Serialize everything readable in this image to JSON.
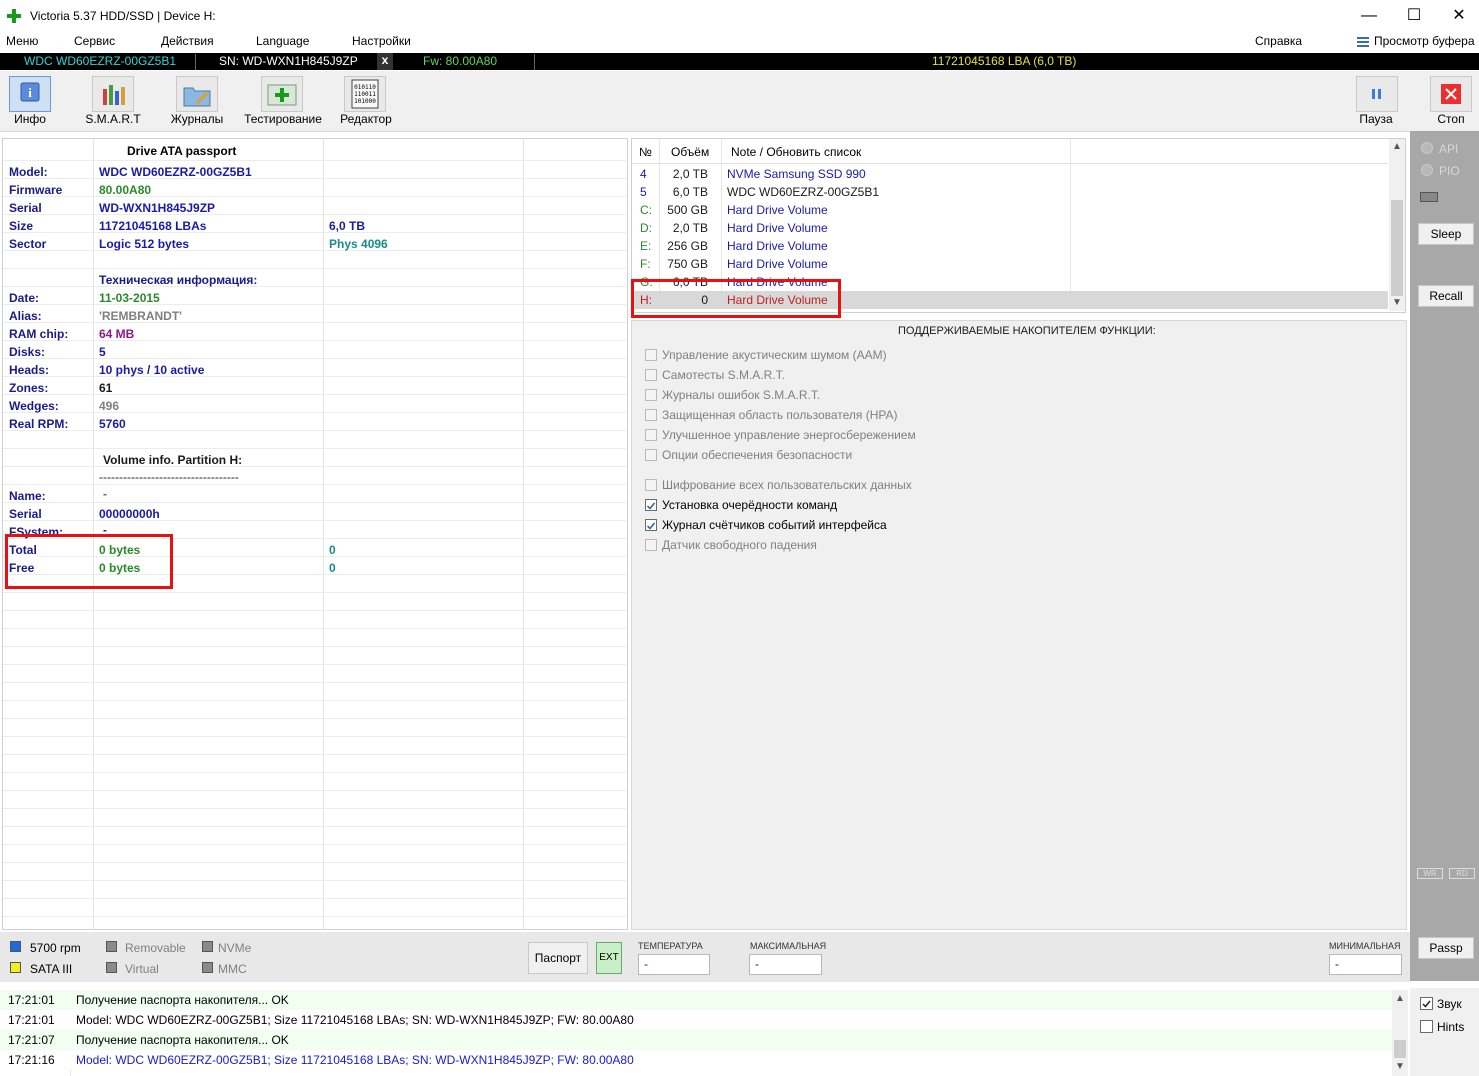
{
  "window": {
    "title": "Victoria 5.37 HDD/SSD | Device H:",
    "min": "—",
    "max": "☐",
    "close": "✕"
  },
  "menu": {
    "items": [
      "Меню",
      "Сервис",
      "Действия",
      "Language",
      "Настройки"
    ],
    "help": "Справка",
    "buffer": "Просмотр буфера"
  },
  "strip": {
    "model": "WDC WD60EZRZ-00GZ5B1",
    "serial": "SN: WD-WXN1H845J9ZP",
    "close": "x",
    "fw": "Fw: 80.00A80",
    "lba": "11721045168 LBA (6,0 TB)"
  },
  "toolbar": {
    "info": "Инфо",
    "smart": "S.M.A.R.T",
    "logs": "Журналы",
    "test": "Тестирование",
    "editor": "Редактор",
    "pause": "Пауза",
    "stop": "Стоп"
  },
  "passport": {
    "header": "Drive ATA passport",
    "model_label": "Model:",
    "model": "WDC WD60EZRZ-00GZ5B1",
    "firmware_label": "Firmware",
    "firmware": "80.00A80",
    "serial_label": "Serial",
    "serial": "WD-WXN1H845J9ZP",
    "size_label": "Size",
    "size": "11721045168 LBAs",
    "size2": "6,0 TB",
    "sector_label": "Sector",
    "sector": "Logic 512 bytes",
    "sector2": "Phys 4096",
    "tech_header": "Техническая информация:",
    "date_label": "Date:",
    "date": "11-03-2015",
    "alias_label": "Alias:",
    "alias": "'REMBRANDT'",
    "ram_label": "RAM chip:",
    "ram": "64 MB",
    "disks_label": "Disks:",
    "disks": "5",
    "heads_label": "Heads:",
    "heads": "10 phys / 10 active",
    "zones_label": "Zones:",
    "zones": "61",
    "wedges_label": "Wedges:",
    "wedges": "496",
    "rpm_label": "Real RPM:",
    "rpm": "5760",
    "vol_header": "Volume info. Partition H:",
    "vol_sep": "-----------------------------------",
    "name_label": "Name:",
    "name": "-",
    "vserial_label": "Serial",
    "vserial": "00000000h",
    "fs_label": "FSystem:",
    "fs": "-",
    "total_label": "Total",
    "total": "0 bytes",
    "total2": "0",
    "free_label": "Free",
    "free": "0 bytes",
    "free2": "0"
  },
  "drives": {
    "col_no": "№",
    "col_size": "Объём",
    "col_note": "Note / Обновить список",
    "rows": [
      {
        "no": "4",
        "size": "2,0 TB",
        "note": "NVMe     Samsung SSD 990"
      },
      {
        "no": "5",
        "size": "6,0 TB",
        "note": "WDC WD60EZRZ-00GZ5B1"
      },
      {
        "no": "C:",
        "size": "500 GB",
        "note": "Hard Drive Volume"
      },
      {
        "no": "D:",
        "size": "2,0 TB",
        "note": "Hard Drive Volume"
      },
      {
        "no": "E:",
        "size": "256 GB",
        "note": "Hard Drive Volume"
      },
      {
        "no": "F:",
        "size": "750 GB",
        "note": "Hard Drive Volume"
      },
      {
        "no": "G:",
        "size": "6,0 TB",
        "note": "Hard Drive Volume"
      },
      {
        "no": "H:",
        "size": "0",
        "note": "Hard Drive Volume"
      }
    ]
  },
  "features": {
    "header": "ПОДДЕРЖИВАЕМЫЕ НАКОПИТЕЛЕМ ФУНКЦИИ:",
    "items": [
      {
        "label": "Управление акустическим шумом (AAM)",
        "checked": false
      },
      {
        "label": "Самотесты S.M.A.R.T.",
        "checked": false
      },
      {
        "label": "Журналы ошибок S.M.A.R.T.",
        "checked": false
      },
      {
        "label": "Защищенная область пользователя (HPA)",
        "checked": false
      },
      {
        "label": "Улучшенное управление энергосбережением",
        "checked": false
      },
      {
        "label": "Опции обеспечения безопасности",
        "checked": false
      },
      {
        "label": "Шифрование всех пользовательских данных",
        "checked": false
      },
      {
        "label": "Установка очерёдности команд",
        "checked": true
      },
      {
        "label": "Журнал счётчиков событий интерфейса",
        "checked": true
      },
      {
        "label": "Датчик свободного падения",
        "checked": false
      }
    ]
  },
  "sidebar": {
    "api": "API",
    "pio": "PIO",
    "sleep": "Sleep",
    "recall": "Recall",
    "wr": "WR",
    "rd": "RD",
    "passp": "Passp",
    "sound": "Звук",
    "hints": "Hints"
  },
  "bottom": {
    "rpm": "5700 rpm",
    "removable": "Removable",
    "nvme": "NVMe",
    "sata": "SATA III",
    "virtual": "Virtual",
    "mmc": "MMC",
    "passport_btn": "Паспорт",
    "ext_btn": "EXT",
    "temp_label": "ТЕМПЕРАТУРА",
    "temp": "-",
    "max_label": "МАКСИМАЛЬНАЯ",
    "max": "-",
    "min_label": "МИНИМАЛЬНАЯ",
    "min": "-"
  },
  "log": [
    {
      "time": "17:21:01",
      "msg": "Получение паспорта накопителя... OK"
    },
    {
      "time": "17:21:01",
      "msg": "Model: WDC WD60EZRZ-00GZ5B1; Size 11721045168 LBAs; SN: WD-WXN1H845J9ZP; FW: 80.00A80"
    },
    {
      "time": "17:21:07",
      "msg": "Получение паспорта накопителя... OK"
    },
    {
      "time": "17:21:16",
      "msg": "Model: WDC WD60EZRZ-00GZ5B1; Size 11721045168 LBAs; SN: WD-WXN1H845J9ZP; FW: 80.00A80"
    }
  ],
  "colors": {
    "accent_red": "#e81010",
    "strip_cyan": "#37d3d3",
    "strip_green": "#5cd65c",
    "strip_yellow": "#e0e040"
  }
}
